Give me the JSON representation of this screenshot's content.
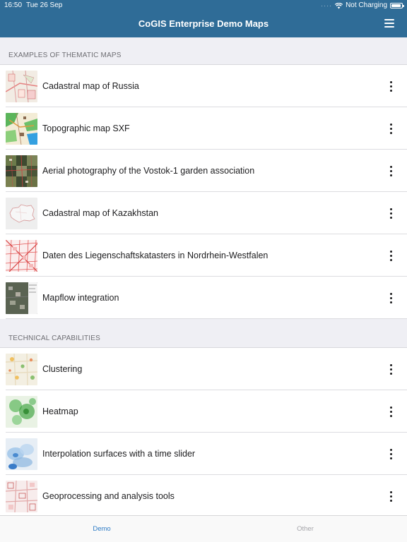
{
  "status_bar": {
    "time": "16:50",
    "date": "Tue 26 Sep",
    "charging": "Not Charging",
    "battery_level": 0.9
  },
  "nav": {
    "title": "CoGIS Enterprise Demo Maps"
  },
  "sections": [
    {
      "title": "EXAMPLES OF THEMATIC MAPS",
      "items": [
        {
          "label": "Cadastral map of Russia",
          "thumb": "cadastral-russia-thumbnail"
        },
        {
          "label": "Topographic map SXF",
          "thumb": "topographic-thumbnail"
        },
        {
          "label": "Aerial photography of the Vostok-1 garden association",
          "thumb": "aerial-photo-thumbnail"
        },
        {
          "label": "Cadastral map of Kazakhstan",
          "thumb": "kazakhstan-outline-thumbnail"
        },
        {
          "label": "Daten des Liegenschaftskatasters in Nordrhein-Westfalen",
          "thumb": "nrw-cadastre-thumbnail"
        },
        {
          "label": "Mapflow integration",
          "thumb": "mapflow-thumbnail"
        }
      ]
    },
    {
      "title": "TECHNICAL CAPABILITIES",
      "items": [
        {
          "label": "Clustering",
          "thumb": "clustering-thumbnail"
        },
        {
          "label": "Heatmap",
          "thumb": "heatmap-thumbnail"
        },
        {
          "label": "Interpolation surfaces with a time slider",
          "thumb": "interpolation-thumbnail"
        },
        {
          "label": "Geoprocessing and analysis tools",
          "thumb": "geoprocessing-thumbnail"
        }
      ]
    }
  ],
  "tabs": [
    {
      "label": "Demo",
      "active": true
    },
    {
      "label": "Other",
      "active": false
    }
  ],
  "colors": {
    "header": "#2f6c97",
    "accent": "#2f7cc6",
    "background": "#efeff4"
  }
}
